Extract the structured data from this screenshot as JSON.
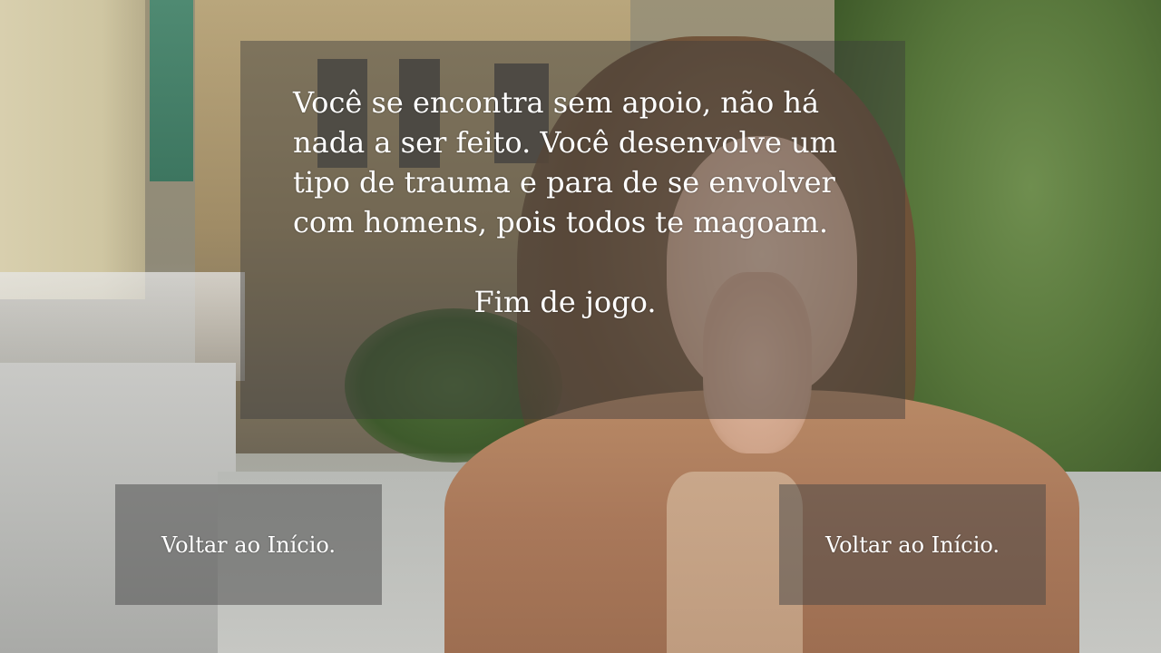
{
  "story": {
    "text": "Você se encontra sem apoio, não há nada a ser feito. Você desenvolve um tipo de trauma e para de se envolver com homens, pois todos te magoam.",
    "ending": "Fim de jogo."
  },
  "choices": [
    {
      "label": "Voltar ao Início."
    },
    {
      "label": "Voltar ao Início."
    }
  ],
  "colors": {
    "panel_overlay": "#3c3c3c",
    "text": "#ffffff"
  }
}
